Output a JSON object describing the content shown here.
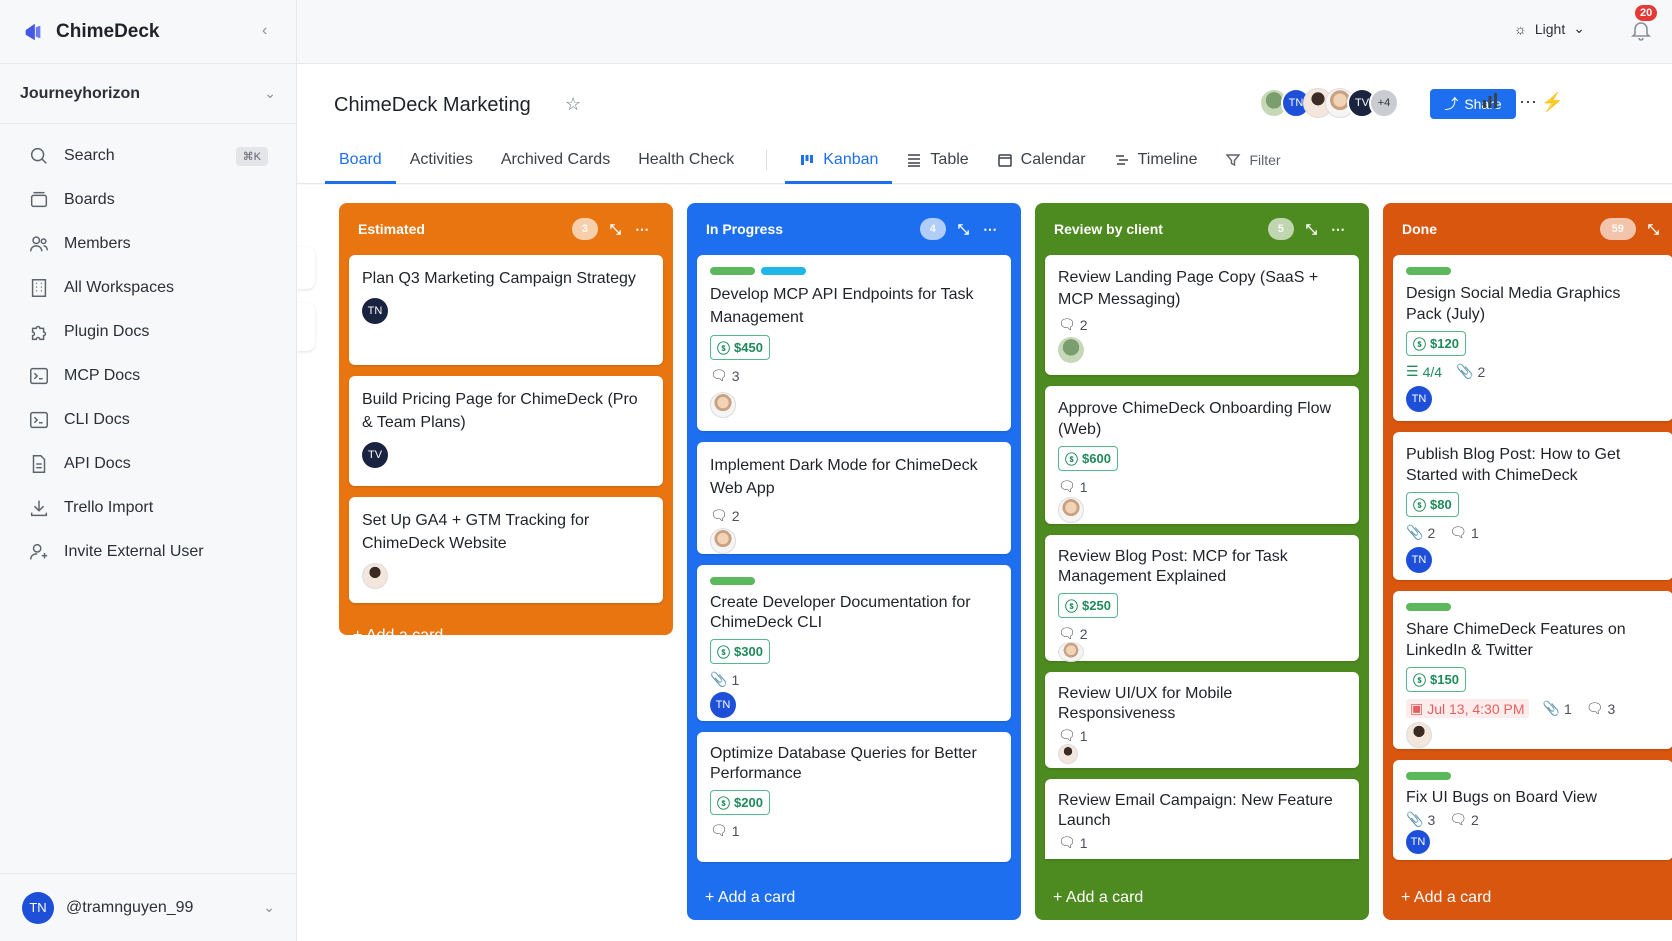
{
  "app": {
    "name": "ChimeDeck"
  },
  "workspace": {
    "name": "Journeyhorizon"
  },
  "sidebar": {
    "items": [
      {
        "label": "Search",
        "icon": "search-icon",
        "shortcut": "⌘K"
      },
      {
        "label": "Boards",
        "icon": "boards-icon"
      },
      {
        "label": "Members",
        "icon": "members-icon"
      },
      {
        "label": "All Workspaces",
        "icon": "building-icon"
      },
      {
        "label": "Plugin Docs",
        "icon": "puzzle-icon"
      },
      {
        "label": "MCP Docs",
        "icon": "terminal-icon"
      },
      {
        "label": "CLI Docs",
        "icon": "terminal-icon"
      },
      {
        "label": "API Docs",
        "icon": "document-icon"
      },
      {
        "label": "Trello Import",
        "icon": "download-icon"
      },
      {
        "label": "Invite External User",
        "icon": "user-plus-icon"
      }
    ]
  },
  "user": {
    "initials": "TN",
    "handle": "@tramnguyen_99"
  },
  "topbar": {
    "theme": "Light",
    "notifications": "20"
  },
  "board": {
    "title": "ChimeDeck Marketing",
    "members_extra": "+4",
    "share_label": "Share",
    "tabs": [
      "Board",
      "Activities",
      "Archived Cards",
      "Health Check"
    ],
    "views": [
      "Kanban",
      "Table",
      "Calendar",
      "Timeline"
    ],
    "filter_label": "Filter"
  },
  "colors": {
    "accent": "#1e6ff0",
    "estimated": "#e8750f",
    "in_progress": "#1e6ff0",
    "review": "#4d8a1f",
    "done": "#d9560f",
    "price": "#1f8a5a"
  },
  "columns": [
    {
      "title": "Estimated",
      "count": "3",
      "color": "#e8750f",
      "cards": [
        {
          "title": "Plan Q3 Marketing Campaign Strategy",
          "avatar": "TN"
        },
        {
          "title": "Build Pricing Page for ChimeDeck (Pro & Team Plans)",
          "avatar": "TV"
        },
        {
          "title": "Set Up GA4 + GTM Tracking for ChimeDeck Website",
          "avatar": "photo"
        }
      ],
      "add_label": "+ Add a card"
    },
    {
      "title": "In Progress",
      "count": "4",
      "color": "#1e6ff0",
      "cards": [
        {
          "title": "Develop MCP API Endpoints for Task Management",
          "price": "$450",
          "comments": "3"
        },
        {
          "title": "Implement Dark Mode for ChimeDeck Web App",
          "comments": "2"
        },
        {
          "title": "Create Developer Documentation for ChimeDeck CLI",
          "price": "$300",
          "attachments": "1",
          "avatar": "TN"
        },
        {
          "title": "Optimize Database Queries for Better Performance",
          "price": "$200",
          "comments": "1"
        }
      ],
      "add_label": "+ Add a card"
    },
    {
      "title": "Review by client",
      "count": "5",
      "color": "#4d8a1f",
      "cards": [
        {
          "title": "Review Landing Page Copy (SaaS + MCP Messaging)",
          "comments": "2"
        },
        {
          "title": "Approve ChimeDeck Onboarding Flow (Web)",
          "price": "$600",
          "comments": "1"
        },
        {
          "title": "Review Blog Post: MCP for Task Management Explained",
          "price": "$250",
          "comments": "2"
        },
        {
          "title": "Review UI/UX for Mobile Responsiveness",
          "comments": "1"
        },
        {
          "title": "Review Email Campaign: New Feature Launch",
          "comments": "1"
        }
      ],
      "add_label": "+ Add a card"
    },
    {
      "title": "Done",
      "count": "59",
      "color": "#d9560f",
      "cards": [
        {
          "title": "Design Social Media Graphics Pack (July)",
          "price": "$120",
          "checklist": "4/4",
          "attachments": "2",
          "avatar": "TN"
        },
        {
          "title": "Publish Blog Post: How to Get Started with ChimeDeck",
          "price": "$80",
          "attachments": "2",
          "comments": "1",
          "avatar": "TN"
        },
        {
          "title": "Share ChimeDeck Features on LinkedIn & Twitter",
          "price": "$150",
          "due": "Jul 13, 4:30 PM",
          "attachments": "1",
          "comments": "3"
        },
        {
          "title": "Fix UI Bugs on Board View",
          "attachments": "3",
          "comments": "2",
          "avatar": "TN"
        }
      ],
      "add_label": "+ Add a card"
    }
  ]
}
